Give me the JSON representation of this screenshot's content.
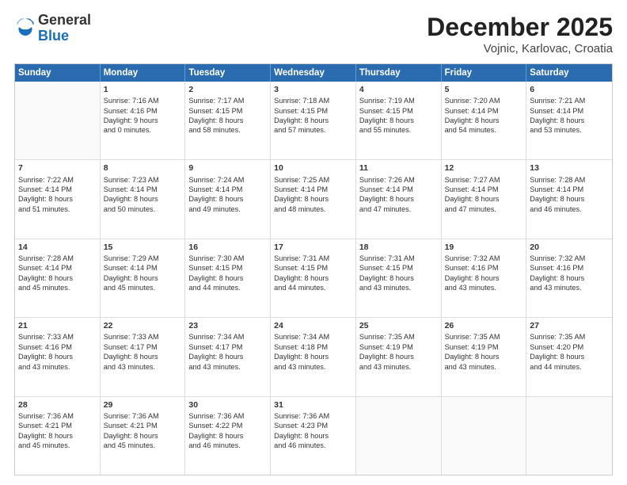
{
  "logo": {
    "general": "General",
    "blue": "Blue"
  },
  "title": "December 2025",
  "subtitle": "Vojnic, Karlovac, Croatia",
  "days": [
    "Sunday",
    "Monday",
    "Tuesday",
    "Wednesday",
    "Thursday",
    "Friday",
    "Saturday"
  ],
  "weeks": [
    [
      {
        "date": "",
        "info": ""
      },
      {
        "date": "1",
        "info": "Sunrise: 7:16 AM\nSunset: 4:16 PM\nDaylight: 9 hours\nand 0 minutes."
      },
      {
        "date": "2",
        "info": "Sunrise: 7:17 AM\nSunset: 4:15 PM\nDaylight: 8 hours\nand 58 minutes."
      },
      {
        "date": "3",
        "info": "Sunrise: 7:18 AM\nSunset: 4:15 PM\nDaylight: 8 hours\nand 57 minutes."
      },
      {
        "date": "4",
        "info": "Sunrise: 7:19 AM\nSunset: 4:15 PM\nDaylight: 8 hours\nand 55 minutes."
      },
      {
        "date": "5",
        "info": "Sunrise: 7:20 AM\nSunset: 4:14 PM\nDaylight: 8 hours\nand 54 minutes."
      },
      {
        "date": "6",
        "info": "Sunrise: 7:21 AM\nSunset: 4:14 PM\nDaylight: 8 hours\nand 53 minutes."
      }
    ],
    [
      {
        "date": "7",
        "info": "Sunrise: 7:22 AM\nSunset: 4:14 PM\nDaylight: 8 hours\nand 51 minutes."
      },
      {
        "date": "8",
        "info": "Sunrise: 7:23 AM\nSunset: 4:14 PM\nDaylight: 8 hours\nand 50 minutes."
      },
      {
        "date": "9",
        "info": "Sunrise: 7:24 AM\nSunset: 4:14 PM\nDaylight: 8 hours\nand 49 minutes."
      },
      {
        "date": "10",
        "info": "Sunrise: 7:25 AM\nSunset: 4:14 PM\nDaylight: 8 hours\nand 48 minutes."
      },
      {
        "date": "11",
        "info": "Sunrise: 7:26 AM\nSunset: 4:14 PM\nDaylight: 8 hours\nand 47 minutes."
      },
      {
        "date": "12",
        "info": "Sunrise: 7:27 AM\nSunset: 4:14 PM\nDaylight: 8 hours\nand 47 minutes."
      },
      {
        "date": "13",
        "info": "Sunrise: 7:28 AM\nSunset: 4:14 PM\nDaylight: 8 hours\nand 46 minutes."
      }
    ],
    [
      {
        "date": "14",
        "info": "Sunrise: 7:28 AM\nSunset: 4:14 PM\nDaylight: 8 hours\nand 45 minutes."
      },
      {
        "date": "15",
        "info": "Sunrise: 7:29 AM\nSunset: 4:14 PM\nDaylight: 8 hours\nand 45 minutes."
      },
      {
        "date": "16",
        "info": "Sunrise: 7:30 AM\nSunset: 4:15 PM\nDaylight: 8 hours\nand 44 minutes."
      },
      {
        "date": "17",
        "info": "Sunrise: 7:31 AM\nSunset: 4:15 PM\nDaylight: 8 hours\nand 44 minutes."
      },
      {
        "date": "18",
        "info": "Sunrise: 7:31 AM\nSunset: 4:15 PM\nDaylight: 8 hours\nand 43 minutes."
      },
      {
        "date": "19",
        "info": "Sunrise: 7:32 AM\nSunset: 4:16 PM\nDaylight: 8 hours\nand 43 minutes."
      },
      {
        "date": "20",
        "info": "Sunrise: 7:32 AM\nSunset: 4:16 PM\nDaylight: 8 hours\nand 43 minutes."
      }
    ],
    [
      {
        "date": "21",
        "info": "Sunrise: 7:33 AM\nSunset: 4:16 PM\nDaylight: 8 hours\nand 43 minutes."
      },
      {
        "date": "22",
        "info": "Sunrise: 7:33 AM\nSunset: 4:17 PM\nDaylight: 8 hours\nand 43 minutes."
      },
      {
        "date": "23",
        "info": "Sunrise: 7:34 AM\nSunset: 4:17 PM\nDaylight: 8 hours\nand 43 minutes."
      },
      {
        "date": "24",
        "info": "Sunrise: 7:34 AM\nSunset: 4:18 PM\nDaylight: 8 hours\nand 43 minutes."
      },
      {
        "date": "25",
        "info": "Sunrise: 7:35 AM\nSunset: 4:19 PM\nDaylight: 8 hours\nand 43 minutes."
      },
      {
        "date": "26",
        "info": "Sunrise: 7:35 AM\nSunset: 4:19 PM\nDaylight: 8 hours\nand 43 minutes."
      },
      {
        "date": "27",
        "info": "Sunrise: 7:35 AM\nSunset: 4:20 PM\nDaylight: 8 hours\nand 44 minutes."
      }
    ],
    [
      {
        "date": "28",
        "info": "Sunrise: 7:36 AM\nSunset: 4:21 PM\nDaylight: 8 hours\nand 45 minutes."
      },
      {
        "date": "29",
        "info": "Sunrise: 7:36 AM\nSunset: 4:21 PM\nDaylight: 8 hours\nand 45 minutes."
      },
      {
        "date": "30",
        "info": "Sunrise: 7:36 AM\nSunset: 4:22 PM\nDaylight: 8 hours\nand 46 minutes."
      },
      {
        "date": "31",
        "info": "Sunrise: 7:36 AM\nSunset: 4:23 PM\nDaylight: 8 hours\nand 46 minutes."
      },
      {
        "date": "",
        "info": ""
      },
      {
        "date": "",
        "info": ""
      },
      {
        "date": "",
        "info": ""
      }
    ]
  ]
}
